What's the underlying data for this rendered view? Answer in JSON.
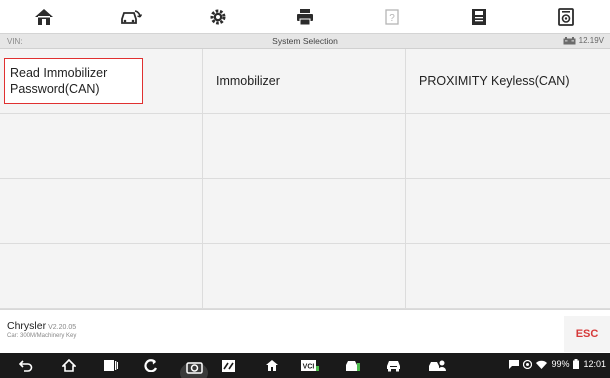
{
  "toolbar": {
    "buttons": [
      {
        "icon": "home-icon"
      },
      {
        "icon": "vehicle-swap-icon"
      },
      {
        "icon": "settings-icon"
      },
      {
        "icon": "print-icon"
      },
      {
        "icon": "help-icon"
      },
      {
        "icon": "save-icon"
      },
      {
        "icon": "data-logging-icon"
      }
    ]
  },
  "statusbar": {
    "vin": "VIN:",
    "title": "System Selection",
    "voltage": "12.19V"
  },
  "grid": {
    "items": [
      {
        "label": "Read Immobilizer\nPassword(CAN)",
        "selected": true
      },
      {
        "label": "Immobilizer"
      },
      {
        "label": "PROXIMITY Keyless(CAN)"
      }
    ]
  },
  "footer": {
    "make": "Chrysler",
    "version": "V2.20.05",
    "car": "Car: 300M/Machinery Key",
    "esc": "ESC"
  },
  "navbar": {
    "time": "12:01",
    "battery": "99%"
  },
  "colors": {
    "accent_red": "#e03030",
    "esc_red": "#d63a3a",
    "navbar_bg": "#1a1a1a"
  }
}
